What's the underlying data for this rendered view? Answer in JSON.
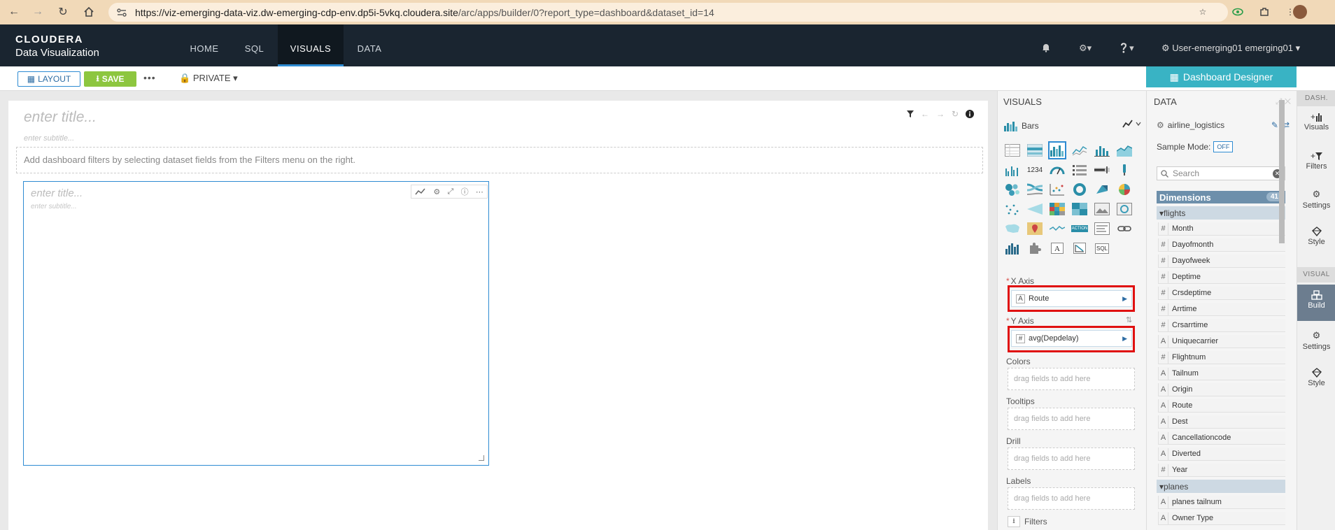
{
  "browser": {
    "url_host": "https://viz-emerging-data-viz.dw-emerging-cdp-env.dp5i-5vkq.cloudera.site",
    "url_path": "/arc/apps/builder/0?report_type=dashboard&dataset_id=14"
  },
  "app": {
    "logo_top": "CLOUDERA",
    "logo_bottom": "Data Visualization",
    "nav": [
      "HOME",
      "SQL",
      "VISUALS",
      "DATA"
    ],
    "active_nav": "VISUALS",
    "user": "User-emerging01 emerging01"
  },
  "toolbar": {
    "layout_label": "LAYOUT",
    "save_label": "SAVE",
    "more_label": "•••",
    "private_label": "PRIVATE"
  },
  "designer_tab": "Dashboard Designer",
  "dashboard": {
    "title_placeholder": "enter title...",
    "subtitle_placeholder": "enter subtitle...",
    "filter_hint": "Add dashboard filters by selecting dataset fields from the Filters menu on the right."
  },
  "visual": {
    "title_placeholder": "enter title...",
    "subtitle_placeholder": "enter subtitle..."
  },
  "visuals_panel": {
    "title": "VISUALS",
    "chart_type": "Bars",
    "x_axis_label": "X Axis",
    "x_axis_field": "Route",
    "y_axis_label": "Y Axis",
    "y_axis_field": "avg(Depdelay)",
    "colors_label": "Colors",
    "tooltips_label": "Tooltips",
    "drill_label": "Drill",
    "labels_label": "Labels",
    "filters_label": "Filters",
    "drop_hint": "drag fields to add here",
    "kpi_text": "1234",
    "action_text": "ACTION",
    "sql_text": "SQL"
  },
  "data_panel": {
    "title": "DATA",
    "dataset": "airline_logistics",
    "sample_label": "Sample Mode:",
    "sample_value": "OFF",
    "search_placeholder": "Search",
    "dimensions_label": "Dimensions",
    "dimensions_count": "41",
    "groups": [
      {
        "name": "flights",
        "fields": [
          {
            "type": "#",
            "name": "Month"
          },
          {
            "type": "#",
            "name": "Dayofmonth"
          },
          {
            "type": "#",
            "name": "Dayofweek"
          },
          {
            "type": "#",
            "name": "Deptime"
          },
          {
            "type": "#",
            "name": "Crsdeptime"
          },
          {
            "type": "#",
            "name": "Arrtime"
          },
          {
            "type": "#",
            "name": "Crsarrtime"
          },
          {
            "type": "A",
            "name": "Uniquecarrier"
          },
          {
            "type": "#",
            "name": "Flightnum"
          },
          {
            "type": "A",
            "name": "Tailnum"
          },
          {
            "type": "A",
            "name": "Origin"
          },
          {
            "type": "A",
            "name": "Route"
          },
          {
            "type": "A",
            "name": "Dest"
          },
          {
            "type": "A",
            "name": "Cancellationcode"
          },
          {
            "type": "A",
            "name": "Diverted"
          },
          {
            "type": "#",
            "name": "Year"
          }
        ]
      },
      {
        "name": "planes",
        "fields": [
          {
            "type": "A",
            "name": "planes tailnum"
          },
          {
            "type": "A",
            "name": "Owner Type"
          }
        ]
      }
    ]
  },
  "rail": {
    "section_dash": "DASH.",
    "section_visual": "VISUAL",
    "dash_items": [
      "Visuals",
      "Filters",
      "Settings",
      "Style"
    ],
    "visual_items": [
      "Build",
      "Settings",
      "Style"
    ],
    "active_item": "Build"
  },
  "colors": {
    "header_bg": "#1a2530",
    "accent_blue": "#2e8bd2",
    "save_green": "#8dc63f",
    "designer_teal": "#39b3c4",
    "highlight_red": "#e01010"
  }
}
